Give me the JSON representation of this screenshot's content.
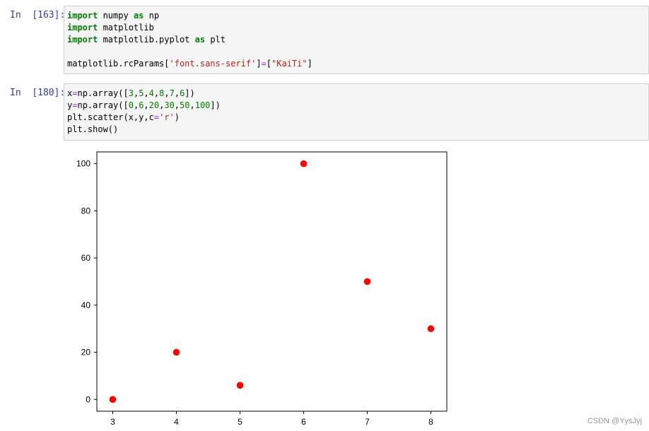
{
  "cells": [
    {
      "prompt": "In  [163]:",
      "lines": [
        [
          {
            "t": "import",
            "c": "kw"
          },
          {
            "t": " numpy "
          },
          {
            "t": "as",
            "c": "kw"
          },
          {
            "t": " np"
          }
        ],
        [
          {
            "t": "import",
            "c": "kw"
          },
          {
            "t": " matplotlib"
          }
        ],
        [
          {
            "t": "import",
            "c": "kw"
          },
          {
            "t": " matplotlib.pyplot "
          },
          {
            "t": "as",
            "c": "kw"
          },
          {
            "t": " plt"
          }
        ],
        [
          {
            "t": ""
          }
        ],
        [
          {
            "t": "matplotlib.rcParams["
          },
          {
            "t": "'font.sans-serif'",
            "c": "str"
          },
          {
            "t": "]"
          },
          {
            "t": "=",
            "c": "op"
          },
          {
            "t": "["
          },
          {
            "t": "\"KaiTi\"",
            "c": "str"
          },
          {
            "t": "]"
          }
        ]
      ]
    },
    {
      "prompt": "In  [180]:",
      "lines": [
        [
          {
            "t": "x"
          },
          {
            "t": "=",
            "c": "op"
          },
          {
            "t": "np.array(["
          },
          {
            "t": "3",
            "c": "num"
          },
          {
            "t": ","
          },
          {
            "t": "5",
            "c": "num"
          },
          {
            "t": ","
          },
          {
            "t": "4",
            "c": "num"
          },
          {
            "t": ","
          },
          {
            "t": "8",
            "c": "num"
          },
          {
            "t": ","
          },
          {
            "t": "7",
            "c": "num"
          },
          {
            "t": ","
          },
          {
            "t": "6",
            "c": "num"
          },
          {
            "t": "])"
          }
        ],
        [
          {
            "t": "y"
          },
          {
            "t": "=",
            "c": "op"
          },
          {
            "t": "np.array(["
          },
          {
            "t": "0",
            "c": "num"
          },
          {
            "t": ","
          },
          {
            "t": "6",
            "c": "num"
          },
          {
            "t": ","
          },
          {
            "t": "20",
            "c": "num"
          },
          {
            "t": ","
          },
          {
            "t": "30",
            "c": "num"
          },
          {
            "t": ","
          },
          {
            "t": "50",
            "c": "num"
          },
          {
            "t": ","
          },
          {
            "t": "100",
            "c": "num"
          },
          {
            "t": "])"
          }
        ],
        [
          {
            "t": "plt.scatter(x,y,c"
          },
          {
            "t": "=",
            "c": "op"
          },
          {
            "t": "'r'",
            "c": "str"
          },
          {
            "t": ")"
          }
        ],
        [
          {
            "t": "plt.show()"
          }
        ]
      ]
    }
  ],
  "chart_data": {
    "type": "scatter",
    "x": [
      3,
      5,
      4,
      8,
      7,
      6
    ],
    "y": [
      0,
      6,
      20,
      30,
      50,
      100
    ],
    "color": "#ff0000",
    "xlim": [
      2.75,
      8.25
    ],
    "ylim": [
      -5,
      105
    ],
    "xticks": [
      3,
      4,
      5,
      6,
      7,
      8
    ],
    "yticks": [
      0,
      20,
      40,
      60,
      80,
      100
    ],
    "title": "",
    "xlabel": "",
    "ylabel": "",
    "grid": false
  },
  "watermark": "CSDN @YysJyj"
}
